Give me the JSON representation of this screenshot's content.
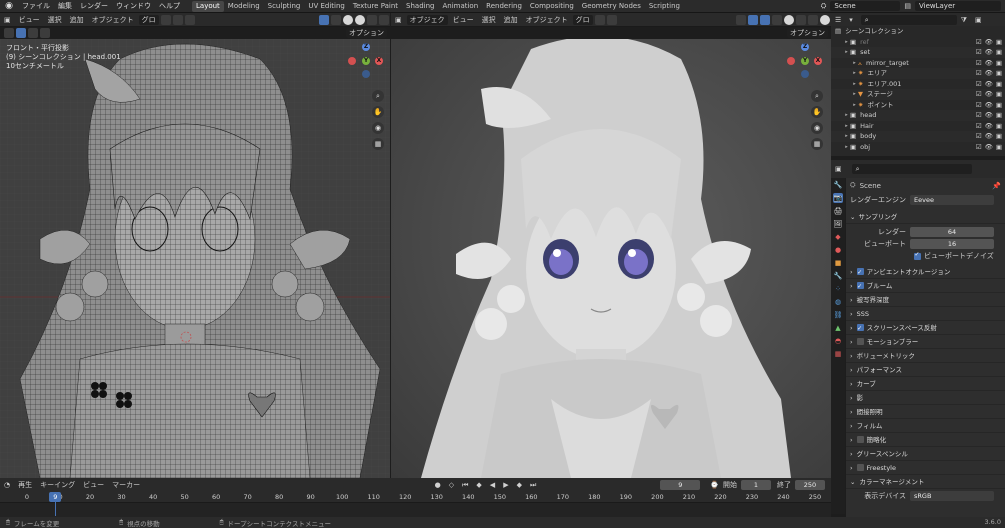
{
  "topbar": {
    "menus": [
      "ファイル",
      "編集",
      "レンダー",
      "ウィンドウ",
      "ヘルプ"
    ],
    "workspaces": [
      "Layout",
      "Modeling",
      "Sculpting",
      "UV Editing",
      "Texture Paint",
      "Shading",
      "Animation",
      "Rendering",
      "Compositing",
      "Geometry Nodes",
      "Scripting"
    ],
    "active_workspace": "Layout",
    "scene": "Scene",
    "view_layer": "ViewLayer"
  },
  "left_viewport": {
    "header": {
      "menus": [
        "ビュー",
        "選択",
        "追加",
        "オブジェクト"
      ],
      "transform": "グロ",
      "options_label": "オプション"
    },
    "overlay_lines": [
      "フロント・平行投影",
      "(9) シーンコレクション | head.001",
      "10センチメートル"
    ]
  },
  "right_viewport": {
    "header": {
      "mode": "オブジェク",
      "menus": [
        "ビュー",
        "選択",
        "追加",
        "オブジェクト"
      ],
      "transform": "グロ",
      "options_label": "オプション"
    }
  },
  "outliner": {
    "root": "シーンコレクション",
    "rows": [
      {
        "label": "ref",
        "indent": 1,
        "icon": "collection",
        "dim": true
      },
      {
        "label": "set",
        "indent": 1,
        "icon": "collection",
        "dim": false
      },
      {
        "label": "mirror_target",
        "indent": 2,
        "icon": "empty",
        "dim": false
      },
      {
        "label": "エリア",
        "indent": 2,
        "icon": "light",
        "dim": false
      },
      {
        "label": "エリア.001",
        "indent": 2,
        "icon": "light",
        "dim": false
      },
      {
        "label": "ステージ",
        "indent": 2,
        "icon": "mesh",
        "dim": false
      },
      {
        "label": "ポイント",
        "indent": 2,
        "icon": "light",
        "dim": false
      },
      {
        "label": "head",
        "indent": 1,
        "icon": "collection",
        "dim": false
      },
      {
        "label": "Hair",
        "indent": 1,
        "icon": "collection",
        "dim": false
      },
      {
        "label": "body",
        "indent": 1,
        "icon": "collection",
        "dim": false
      },
      {
        "label": "obj",
        "indent": 1,
        "icon": "collection",
        "dim": false
      }
    ]
  },
  "properties": {
    "scene_name": "Scene",
    "render_engine_label": "レンダーエンジン",
    "render_engine": "Eevee",
    "sampling": {
      "title": "サンプリング",
      "render_label": "レンダー",
      "render_value": "64",
      "viewport_label": "ビューポート",
      "viewport_value": "16",
      "denoise_label": "ビューポートデノイズ"
    },
    "sections": [
      {
        "label": "アンビエントオクルージョン",
        "checkbox": true,
        "checked": true
      },
      {
        "label": "ブルーム",
        "checkbox": true,
        "checked": true
      },
      {
        "label": "被写界深度",
        "checkbox": false,
        "checked": false
      },
      {
        "label": "SSS",
        "checkbox": false,
        "checked": false
      },
      {
        "label": "スクリーンスペース反射",
        "checkbox": true,
        "checked": true
      },
      {
        "label": "モーションブラー",
        "checkbox": true,
        "checked": false
      },
      {
        "label": "ボリューメトリック",
        "checkbox": false,
        "checked": false
      },
      {
        "label": "パフォーマンス",
        "checkbox": false,
        "checked": false
      },
      {
        "label": "カーブ",
        "checkbox": false,
        "checked": false
      },
      {
        "label": "影",
        "checkbox": false,
        "checked": false
      },
      {
        "label": "間接照明",
        "checkbox": false,
        "checked": false
      },
      {
        "label": "フィルム",
        "checkbox": false,
        "checked": false
      },
      {
        "label": "簡略化",
        "checkbox": true,
        "checked": false
      },
      {
        "label": "グリースペンシル",
        "checkbox": false,
        "checked": false
      },
      {
        "label": "Freestyle",
        "checkbox": true,
        "checked": false
      },
      {
        "label": "カラーマネージメント",
        "checkbox": false,
        "checked": false,
        "open": true
      }
    ],
    "display_device_label": "表示デバイス",
    "display_device": "sRGB"
  },
  "timeline": {
    "menus": [
      "再生",
      "キーイング",
      "ビュー",
      "マーカー"
    ],
    "current_frame": "9",
    "start_label": "開始",
    "start": "1",
    "end_label": "終了",
    "end": "250",
    "ticks": [
      "0",
      "10",
      "20",
      "30",
      "40",
      "50",
      "60",
      "70",
      "80",
      "90",
      "100",
      "110",
      "120",
      "130",
      "140",
      "150",
      "160",
      "170",
      "180",
      "190",
      "200",
      "210",
      "220",
      "230",
      "240",
      "250"
    ],
    "frame_marker": "9"
  },
  "statusbar": {
    "items": [
      "フレームを変更",
      "視点の移動",
      "ドープシートコンテクストメニュー"
    ],
    "version": "3.6.0"
  }
}
